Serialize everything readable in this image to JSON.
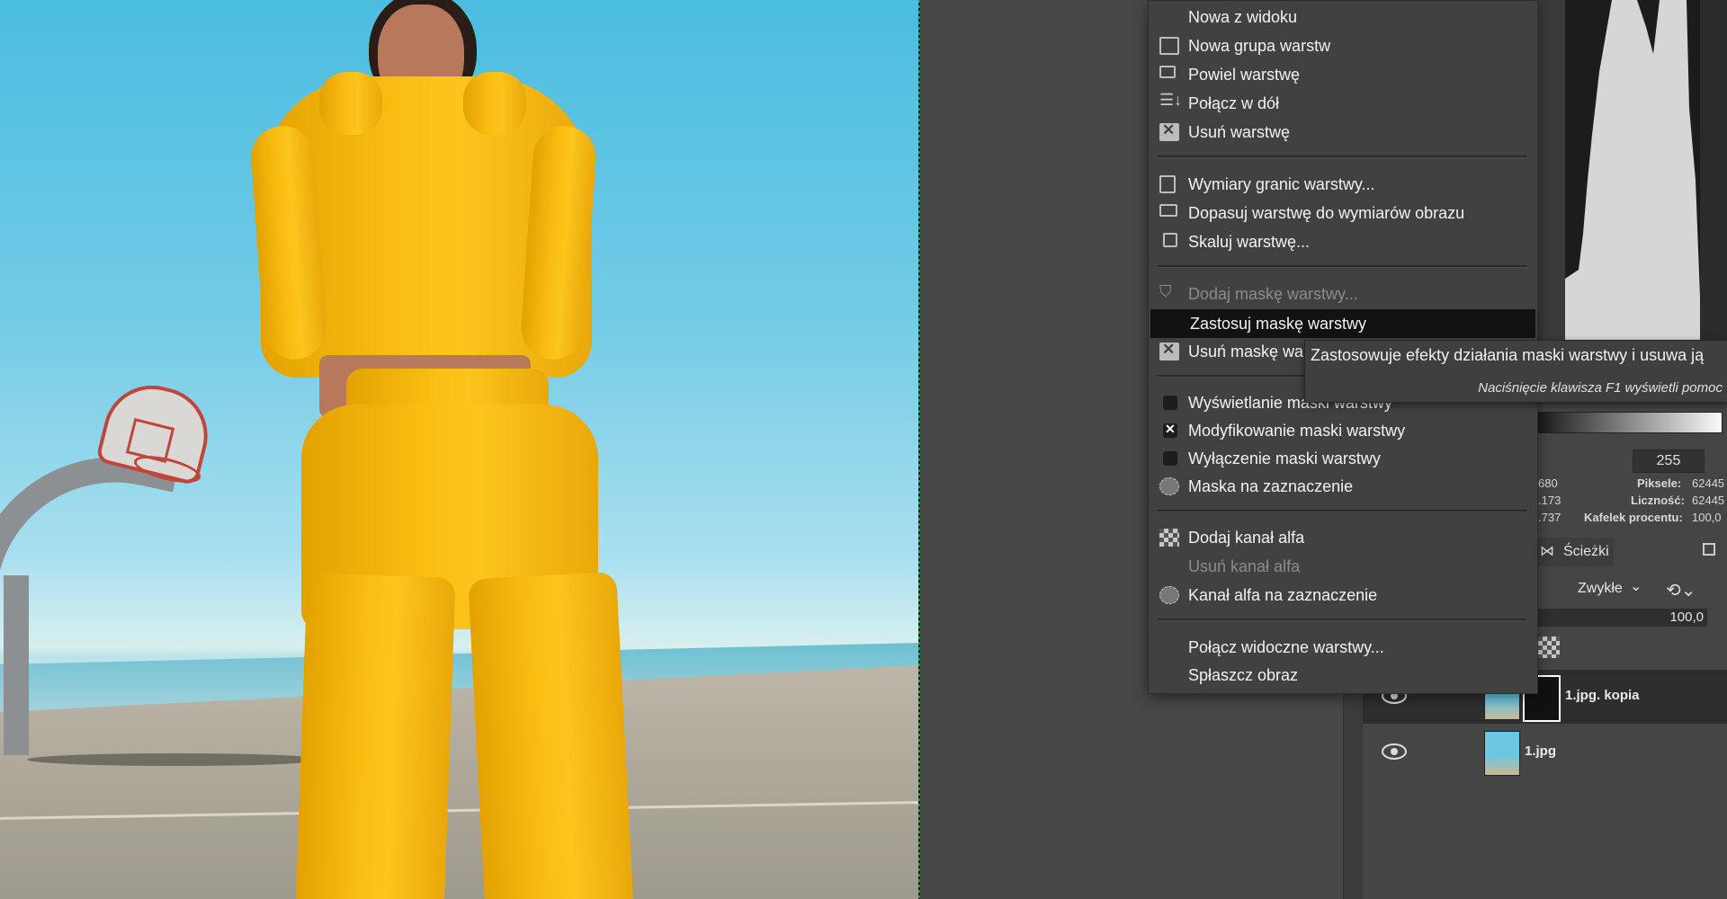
{
  "menu": {
    "items": [
      {
        "label": "Nowa z widoku",
        "icon": "none",
        "disabled": false
      },
      {
        "label": "Nowa grupa warstw",
        "icon": "new-layer-group-icon",
        "disabled": false
      },
      {
        "label": "Powiel warstwę",
        "icon": "duplicate-layer-icon",
        "disabled": false
      },
      {
        "label": "Połącz w dół",
        "icon": "merge-down-icon",
        "disabled": false
      },
      {
        "label": "Usuń warstwę",
        "icon": "delete-icon",
        "disabled": false
      },
      {
        "label": "Wymiary granic warstwy...",
        "icon": "layer-boundary-icon",
        "disabled": false
      },
      {
        "label": "Dopasuj warstwę do wymiarów obrazu",
        "icon": "layer-to-image-size-icon",
        "disabled": false
      },
      {
        "label": "Skaluj warstwę...",
        "icon": "scale-layer-icon",
        "disabled": false
      },
      {
        "label": "Dodaj maskę warstwy...",
        "icon": "add-mask-icon",
        "disabled": true
      },
      {
        "label": "Zastosuj maskę warstwy",
        "icon": "none",
        "disabled": false,
        "highlighted": true
      },
      {
        "label": "Usuń maskę warstwy",
        "icon": "delete-icon",
        "disabled": false
      },
      {
        "label": "Wyświetlanie maski warstwy",
        "icon": "checkbox",
        "checked": false
      },
      {
        "label": "Modyfikowanie maski warstwy",
        "icon": "checkbox",
        "checked": true
      },
      {
        "label": "Wyłączenie maski warstwy",
        "icon": "checkbox",
        "checked": false
      },
      {
        "label": "Maska na zaznaczenie",
        "icon": "mask-to-selection-icon",
        "disabled": false
      },
      {
        "label": "Dodaj kanał alfa",
        "icon": "alpha-icon",
        "disabled": false
      },
      {
        "label": "Usuń kanał alfa",
        "icon": "none",
        "disabled": true
      },
      {
        "label": "Kanał alfa na zaznaczenie",
        "icon": "alpha-to-selection-icon",
        "disabled": false
      },
      {
        "label": "Połącz widoczne warstwy...",
        "icon": "none",
        "disabled": false
      },
      {
        "label": "Spłaszcz obraz",
        "icon": "none",
        "disabled": false
      }
    ]
  },
  "tooltip": {
    "text": "Zastosowuje efekty działania maski warstwy i usuwa ją",
    "hint": "Naciśnięcie klawisza F1 wyświetli pomoc"
  },
  "histogram": {
    "range_max": "255",
    "stats_left": [
      "680",
      ".173",
      ".737"
    ],
    "stats_labels": [
      "Piksele:",
      "Liczność:",
      "Kafelek procentu:"
    ],
    "stats_values": [
      "62445",
      "62445",
      "100,0"
    ]
  },
  "layers_panel": {
    "tab_paths": "Ścieżki",
    "mode": "Zwykłe",
    "opacity": "100,0",
    "layers": [
      {
        "name": "1.jpg. kopia",
        "has_mask": true,
        "selected": true
      },
      {
        "name": "1.jpg",
        "has_mask": false,
        "selected": false
      }
    ]
  },
  "colors": {
    "menu_bg": "#414141",
    "highlight": "#121212",
    "canvas_dash": "#2c9a32"
  }
}
